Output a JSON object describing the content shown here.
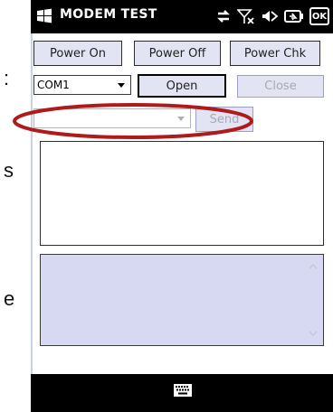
{
  "background_fragments": {
    "colon": ":",
    "s": "s",
    "e": "e"
  },
  "titlebar": {
    "title": "MODEM TEST",
    "ok_label": "OK"
  },
  "buttons": {
    "power_on": "Power On",
    "power_off": "Power Off",
    "power_chk": "Power Chk",
    "open": "Open",
    "close": "Close",
    "send": "Send"
  },
  "port_select": {
    "value": "COM1"
  },
  "command_select": {
    "value": ""
  },
  "output_box": {
    "value": ""
  },
  "log_box": {
    "value": ""
  },
  "colors": {
    "button_face": "#e2e4f4",
    "log_background": "#d7d9f3",
    "highlight_ellipse": "#b01a1a",
    "bar": "#000000"
  },
  "icons": [
    "windows-logo-icon",
    "sync-icon",
    "no-signal-icon",
    "speaker-muted-icon",
    "battery-charging-icon",
    "keyboard-icon"
  ]
}
